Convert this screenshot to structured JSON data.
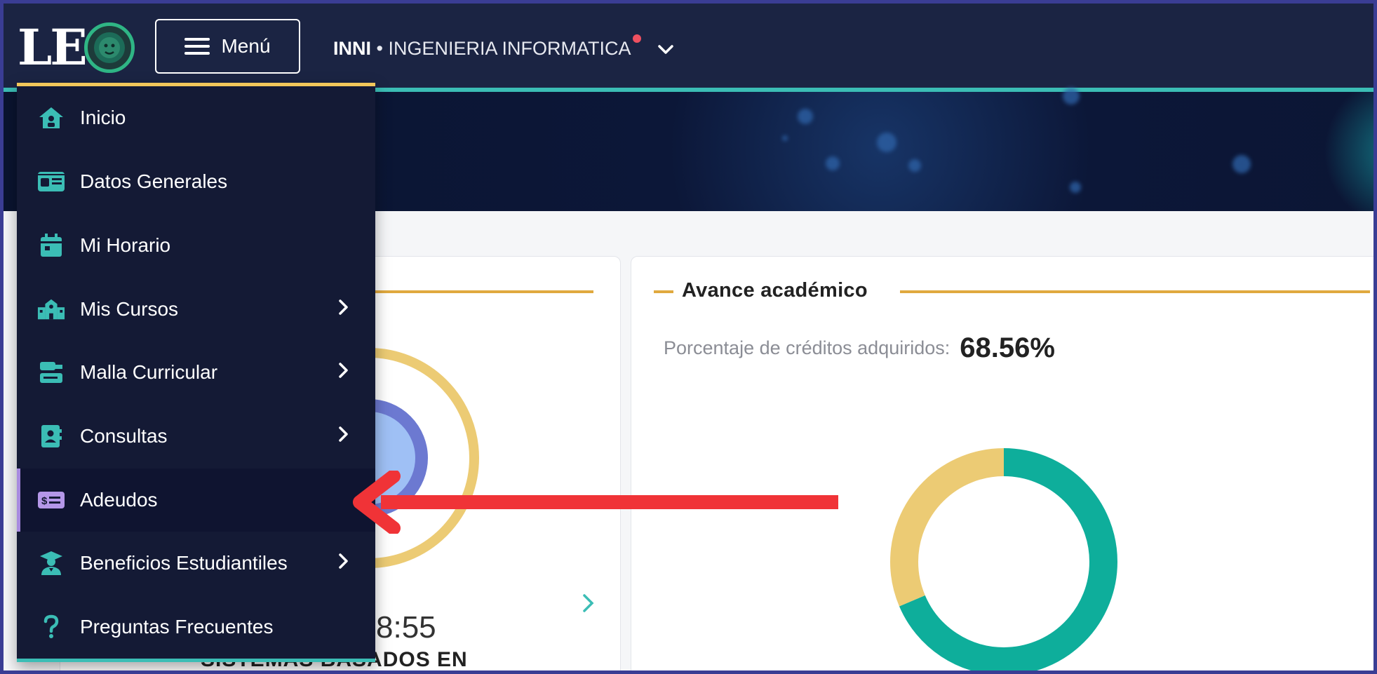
{
  "header": {
    "logo_text": "LE",
    "menu_label": "Menú",
    "program_code": "INNI",
    "program_separator": " • ",
    "program_name": "INGENIERIA INFORMATICA"
  },
  "menu": {
    "items": [
      {
        "label": "Inicio",
        "icon": "home-icon",
        "has_submenu": false
      },
      {
        "label": "Datos Generales",
        "icon": "id-card-icon",
        "has_submenu": false
      },
      {
        "label": "Mi Horario",
        "icon": "calendar-icon",
        "has_submenu": false
      },
      {
        "label": "Mis Cursos",
        "icon": "school-icon",
        "has_submenu": true
      },
      {
        "label": "Malla Curricular",
        "icon": "curriculum-icon",
        "has_submenu": true
      },
      {
        "label": "Consultas",
        "icon": "contact-book-icon",
        "has_submenu": true
      },
      {
        "label": "Adeudos",
        "icon": "money-bill-icon",
        "has_submenu": false,
        "active": true
      },
      {
        "label": "Beneficios Estudiantiles",
        "icon": "graduate-icon",
        "has_submenu": true
      },
      {
        "label": "Preguntas Frecuentes",
        "icon": "question-icon",
        "has_submenu": false
      }
    ]
  },
  "academic_progress": {
    "title": "Avance académico",
    "credits_label": "Porcentaje de créditos adquiridos:",
    "credits_value": "68.56%"
  },
  "schedule_card": {
    "time_partial": "8:55",
    "course_partial": "SISTEMAS BASADOS EN"
  },
  "chart_data": {
    "type": "pie",
    "values": [
      68.56,
      31.44
    ],
    "colors": [
      "#0eae9b",
      "#eccb74"
    ]
  },
  "colors": {
    "navbar": "#1b2443",
    "accent_teal": "#3bbdb5",
    "accent_gold": "#e0a93f",
    "menu_bg": "#141a35",
    "active_marker": "#a88be0",
    "annotation_arrow": "#f03337"
  }
}
